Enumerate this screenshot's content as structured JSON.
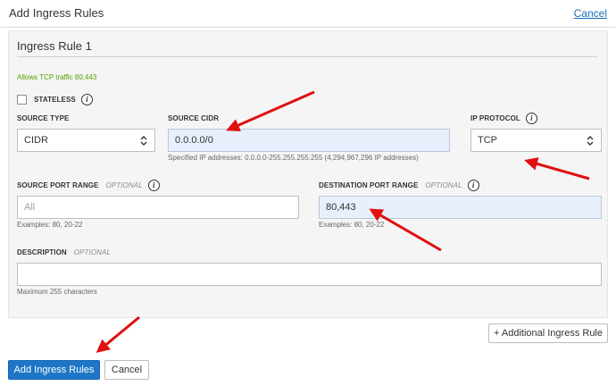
{
  "dialog": {
    "title": "Add Ingress Rules",
    "cancel_link": "Cancel"
  },
  "rule": {
    "title": "Ingress Rule 1",
    "hint": "Allows TCP traffic 80,443",
    "stateless_label": "STATELESS",
    "stateless_checked": false,
    "source_type": {
      "label": "SOURCE TYPE",
      "value": "CIDR"
    },
    "source_cidr": {
      "label": "SOURCE CIDR",
      "value": "0.0.0.0/0",
      "help": "Specified IP addresses: 0.0.0.0-255.255.255.255 (4,294,967,296 IP addresses)"
    },
    "ip_protocol": {
      "label": "IP PROTOCOL",
      "value": "TCP"
    },
    "source_port_range": {
      "label": "SOURCE PORT RANGE",
      "optional": "OPTIONAL",
      "placeholder": "All",
      "help": "Examples: 80, 20-22"
    },
    "destination_port_range": {
      "label": "DESTINATION PORT RANGE",
      "optional": "OPTIONAL",
      "value": "80,443",
      "help": "Examples: 80, 20-22"
    },
    "description": {
      "label": "DESCRIPTION",
      "optional": "OPTIONAL",
      "value": "",
      "help": "Maximum 255 characters"
    }
  },
  "buttons": {
    "additional_rule": "+ Additional Ingress Rule",
    "add_rules": "Add Ingress Rules",
    "cancel": "Cancel"
  },
  "icons": {
    "info": "i"
  },
  "colors": {
    "primary": "#1f76c7",
    "link": "#1a6fb5",
    "hint": "#55a000",
    "annotation_arrow": "#e01010",
    "filled_field": "#e8f0fe"
  }
}
